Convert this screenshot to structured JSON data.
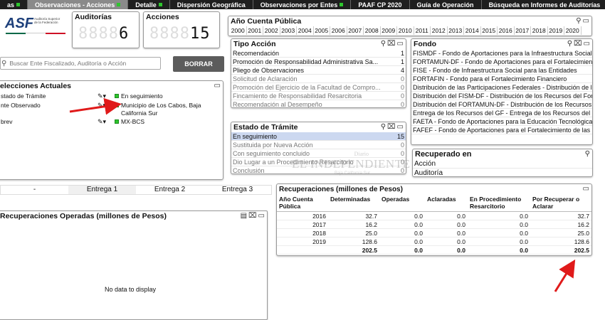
{
  "tabs": [
    {
      "label": "as",
      "active": false,
      "marker": true
    },
    {
      "label": "Observaciones - Acciones",
      "active": true,
      "marker": true
    },
    {
      "label": "Detalle",
      "active": false,
      "marker": true
    },
    {
      "label": "Dispersión Geográfica",
      "active": false,
      "marker": false
    },
    {
      "label": "Observaciones por Entes",
      "active": false,
      "marker": true
    },
    {
      "label": "PAAF CP 2020",
      "active": false,
      "marker": false
    },
    {
      "label": "Guía de Operación",
      "active": false,
      "marker": false
    },
    {
      "label": "Búsqueda en Informes de Auditorías",
      "active": false,
      "marker": false
    }
  ],
  "logo": {
    "text": "ASF",
    "sub": "Auditoría Superior de la Federación",
    "flag_colors": [
      "#006847",
      "#ffffff",
      "#ce1126"
    ]
  },
  "auditorias": {
    "label": "Auditorías",
    "ghost": "8888",
    "value": "6"
  },
  "acciones": {
    "label": "Acciones",
    "ghost": "8888",
    "value": "15"
  },
  "search": {
    "placeholder": "Buscar Ente Fiscalizado, Auditoría o Acción",
    "button": "BORRAR"
  },
  "selecciones": {
    "title": "elecciones Actuales",
    "rows": [
      {
        "field": "stado de Trámite",
        "value": "En seguimiento"
      },
      {
        "field": "nte Observado",
        "value": "Municipio de Los Cabos, Baja California Sur"
      },
      {
        "field": "brev",
        "value": "MX-BCS"
      }
    ]
  },
  "anio": {
    "title": "Año Cuenta Pública",
    "years": [
      "2000",
      "2001",
      "2002",
      "2003",
      "2004",
      "2005",
      "2006",
      "2007",
      "2008",
      "2009",
      "2010",
      "2011",
      "2012",
      "2013",
      "2014",
      "2015",
      "2016",
      "2017",
      "2018",
      "2019",
      "2020"
    ]
  },
  "tipo_accion": {
    "title": "Tipo Acción",
    "rows": [
      {
        "label": "Recomendación",
        "count": "1",
        "state": "normal"
      },
      {
        "label": "Promoción de Responsabilidad Administrativa Sa...",
        "count": "1",
        "state": "normal"
      },
      {
        "label": "Pliego de Observaciones",
        "count": "4",
        "state": "normal"
      },
      {
        "label": "Solicitud de Aclaración",
        "count": "0",
        "state": "gray"
      },
      {
        "label": "Promoción del Ejercicio de la Facultad de Compro...",
        "count": "0",
        "state": "gray"
      },
      {
        "label": "Fincamiento de Responsabilidad Resarcitoria",
        "count": "0",
        "state": "gray"
      },
      {
        "label": "Recomendación al Desempeño",
        "count": "0",
        "state": "gray"
      }
    ]
  },
  "estado_tramite": {
    "title": "Estado de Trámite",
    "rows": [
      {
        "label": "En seguimiento",
        "count": "15",
        "state": "sel"
      },
      {
        "label": "Sustituida por Nueva Acción",
        "count": "0",
        "state": "gray"
      },
      {
        "label": "Con seguimiento concluido",
        "count": "0",
        "state": "gray"
      },
      {
        "label": "Dio Lugar a un Procedimiento Resarcitorio",
        "count": "0",
        "state": "gray"
      },
      {
        "label": "Conclusión",
        "count": "0",
        "state": "gray"
      }
    ]
  },
  "fondo": {
    "title": "Fondo",
    "rows": [
      "FISMDF - Fondo de Aportaciones para la Infraestructura Social Muni",
      "FORTAMUN-DF - Fondo de Aportaciones para el Fortalecimiento de",
      "FISE - Fondo de Infraestructura Social para las Entidades",
      "FORTAFIN - Fondo para el Fortalecimiento Financiero",
      "Distribución de las Participaciones Federales - Distribución de las Pa",
      "Distribución del FISM-DF - Distribución de los Recursos del Fondo d",
      "Distribución del FORTAMUN-DF - Distribución de los Recursos del Fo",
      "Entrega de los Recursos del GF - Entrega de los Recursos del GF",
      "FAETA - Fondo de Aportaciones para la Educación Tecnológica y de",
      "FAFEF - Fondo de Aportaciones para el Fortalecimiento de las Entida"
    ]
  },
  "recuperado": {
    "title": "Recuperado en",
    "rows": [
      "Acción",
      "Auditoría"
    ]
  },
  "entregas": {
    "items": [
      "-",
      "Entrega 1",
      "Entrega 2",
      "Entrega 3"
    ]
  },
  "rec_operadas": {
    "title": "Recuperaciones Operadas (millones de Pesos)",
    "empty": "No data to display"
  },
  "watermark": {
    "top": "Diario",
    "main": "EL INDEPENDIENTE",
    "sub": "Baja California Sur"
  },
  "recuperaciones": {
    "title": "Recuperaciones (millones de Pesos)",
    "headers": [
      "Año Cuenta Pública",
      "Determinadas",
      "Operadas",
      "Aclaradas",
      "En Procedimiento Resarcitorio",
      "Por Recuperar o Aclarar"
    ],
    "rows": [
      [
        "2016",
        "32.7",
        "0.0",
        "0.0",
        "0.0",
        "32.7"
      ],
      [
        "2017",
        "16.2",
        "0.0",
        "0.0",
        "0.0",
        "16.2"
      ],
      [
        "2018",
        "25.0",
        "0.0",
        "0.0",
        "0.0",
        "25.0"
      ],
      [
        "2019",
        "128.6",
        "0.0",
        "0.0",
        "0.0",
        "128.6"
      ]
    ],
    "total": [
      "",
      "202.5",
      "0.0",
      "0.0",
      "0.0",
      "202.5"
    ]
  },
  "annotation_color": "#e01a1a"
}
